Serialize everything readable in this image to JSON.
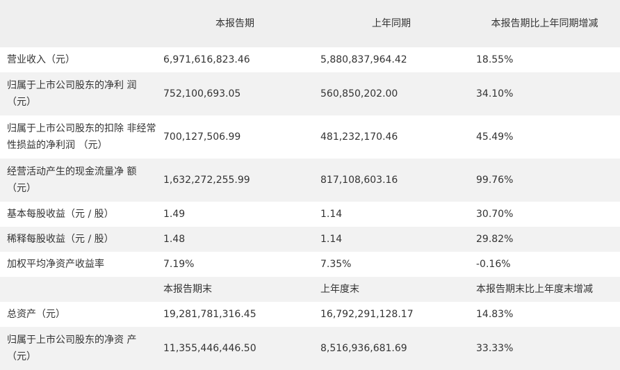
{
  "header": {
    "col0": "",
    "col1": "本报告期",
    "col2": "上年同期",
    "col3": "本报告期比上年同期增减"
  },
  "rows": [
    {
      "label": "营业收入（元）",
      "current": "6,971,616,823.46",
      "prior": "5,880,837,964.42",
      "change": "18.55%"
    },
    {
      "label": "归属于上市公司股东的净利 润（元）",
      "current": "752,100,693.05",
      "prior": "560,850,202.00",
      "change": "34.10%"
    },
    {
      "label": "归属于上市公司股东的扣除 非经常性损益的净利润 （元）",
      "current": "700,127,506.99",
      "prior": "481,232,170.46",
      "change": "45.49%"
    },
    {
      "label": "经营活动产生的现金流量净 额（元）",
      "current": "1,632,272,255.99",
      "prior": "817,108,603.16",
      "change": "99.76%"
    },
    {
      "label": "基本每股收益（元 / 股）",
      "current": "1.49",
      "prior": "1.14",
      "change": "30.70%"
    },
    {
      "label": "稀释每股收益（元 / 股）",
      "current": "1.48",
      "prior": "1.14",
      "change": "29.82%"
    },
    {
      "label": "加权平均净资产收益率",
      "current": "7.19%",
      "prior": "7.35%",
      "change": "-0.16%"
    },
    {
      "label": "",
      "current": "本报告期末",
      "prior": "上年度末",
      "change": "本报告期末比上年度末增减"
    },
    {
      "label": "总资产（元）",
      "current": "19,281,781,316.45",
      "prior": "16,792,291,128.17",
      "change": "14.83%"
    },
    {
      "label": "归属于上市公司股东的净资 产（元）",
      "current": "11,355,446,446.50",
      "prior": "8,516,936,681.69",
      "change": "33.33%"
    }
  ]
}
